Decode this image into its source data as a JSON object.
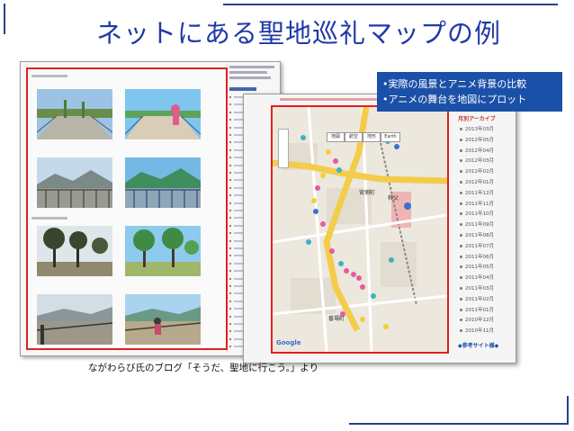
{
  "slide": {
    "title": "ネットにある聖地巡礼マップの例",
    "caption": "ながわらび氏のブログ「そうだ、聖地に行こう。」より"
  },
  "callout": {
    "line1": "•実際の風景とアニメ背景の比較",
    "line2": "•アニメの舞台を地図にプロット"
  },
  "map": {
    "buttons": [
      "地図",
      "航空",
      "地形",
      "Earth"
    ],
    "station_label": "秩父",
    "district_label": "宮側町",
    "district_label2": "番場町",
    "google_label": "Google"
  },
  "right_sidebar": {
    "heading": "月別アーカイブ",
    "items": [
      "2013年03月",
      "2012年05月",
      "2012年04月",
      "2012年03月",
      "2012年02月",
      "2012年01月",
      "2011年12月",
      "2011年11月",
      "2011年10月",
      "2011年09月",
      "2011年08月",
      "2011年07月",
      "2011年06月",
      "2011年05月",
      "2011年04月",
      "2011年03月",
      "2011年02月",
      "2011年01月",
      "2010年12月",
      "2010年11月"
    ],
    "links_heading": "◆参考サイト様◆"
  },
  "colors": {
    "title": "#1f3aa6",
    "callout_bg": "#1b50a8",
    "frame_red": "#e02020",
    "deco_line": "#2b3f8c"
  }
}
